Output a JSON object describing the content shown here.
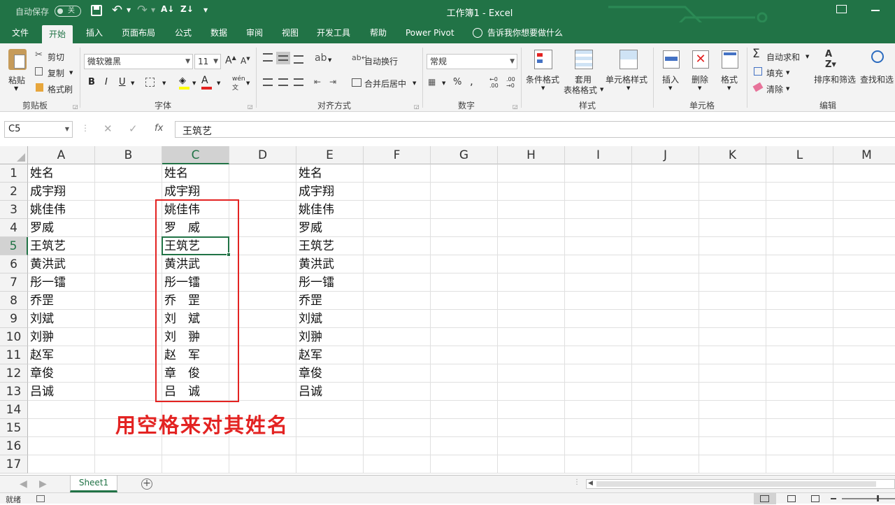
{
  "titlebar": {
    "autosave_label": "自动保存",
    "autosave_state": "关",
    "title": "工作簿1 - Excel"
  },
  "tabs": [
    "文件",
    "开始",
    "插入",
    "页面布局",
    "公式",
    "数据",
    "审阅",
    "视图",
    "开发工具",
    "帮助",
    "Power Pivot"
  ],
  "tell_me": "告诉我你想要做什么",
  "ribbon": {
    "clipboard": {
      "paste": "粘贴",
      "cut": "剪切",
      "copy": "复制",
      "format_painter": "格式刷",
      "label": "剪贴板"
    },
    "font": {
      "name": "微软雅黑",
      "size": "11",
      "label": "字体"
    },
    "alignment": {
      "wrap": "自动换行",
      "merge": "合并后居中",
      "label": "对齐方式"
    },
    "number": {
      "format": "常规",
      "label": "数字"
    },
    "styles": {
      "cond": "条件格式",
      "table1": "套用",
      "table2": "表格格式",
      "cell_styles": "单元格样式",
      "label": "样式"
    },
    "cells": {
      "insert": "插入",
      "delete": "删除",
      "format": "格式",
      "label": "单元格"
    },
    "editing": {
      "autosum": "自动求和",
      "fill": "填充",
      "clear": "清除",
      "sort": "排序和筛选",
      "find": "查找和选",
      "label": "编辑"
    }
  },
  "formula_bar": {
    "name_box": "C5",
    "fx": "fx",
    "content": "王筑艺"
  },
  "columns": [
    "A",
    "B",
    "C",
    "D",
    "E",
    "F",
    "G",
    "H",
    "I",
    "J",
    "K",
    "L",
    "M"
  ],
  "selected_column": "C",
  "selected_row": "5",
  "rows": [
    "1",
    "2",
    "3",
    "4",
    "5",
    "6",
    "7",
    "8",
    "9",
    "10",
    "11",
    "12",
    "13",
    "14",
    "15",
    "16",
    "17"
  ],
  "col_a": [
    "姓名",
    "成宇翔",
    "姚佳伟",
    "罗威",
    "王筑艺",
    "黄洪武",
    "彤一镭",
    "乔罡",
    "刘斌",
    "刘翀",
    "赵军",
    "章俊",
    "吕诚"
  ],
  "col_c": [
    "姓名",
    "成宇翔",
    "姚佳伟",
    "罗　威",
    "王筑艺",
    "黄洪武",
    "彤一镭",
    "乔　罡",
    "刘　斌",
    "刘　翀",
    "赵　军",
    "章　俊",
    "吕　诚"
  ],
  "col_e": [
    "姓名",
    "成宇翔",
    "姚佳伟",
    "罗威",
    "王筑艺",
    "黄洪武",
    "彤一镭",
    "乔罡",
    "刘斌",
    "刘翀",
    "赵军",
    "章俊",
    "吕诚"
  ],
  "annotation": {
    "text": "用空格来对其姓名",
    "color": "#e32322"
  },
  "sheet_tab": "Sheet1",
  "status": "就绪",
  "colors": {
    "accent": "#217346",
    "highlight_box": "#e32322"
  }
}
